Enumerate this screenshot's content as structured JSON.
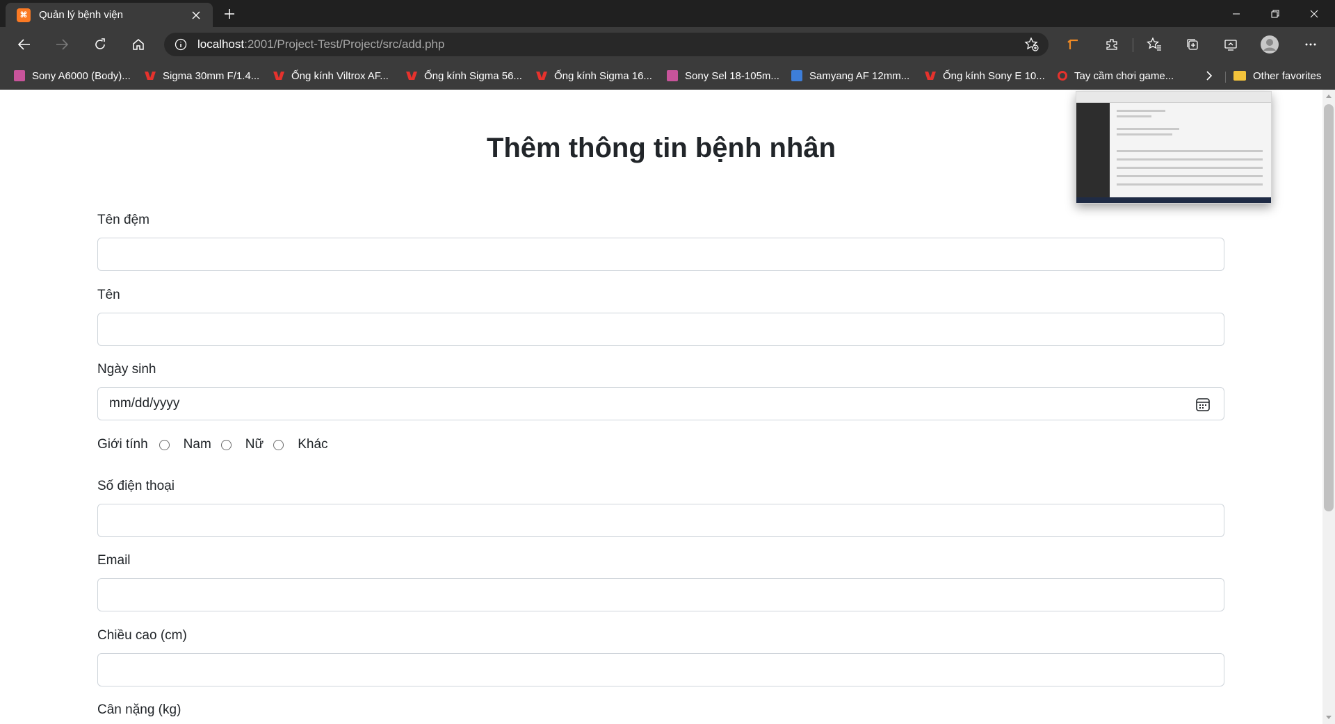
{
  "browser": {
    "tab": {
      "title": "Quản lý bệnh viện",
      "favicon": "xampp-icon"
    },
    "address": {
      "host": "localhost",
      "path": ":2001/Project-Test/Project/src/add.php"
    },
    "favorites": [
      {
        "label": "Sony A6000 (Body)...",
        "icon": "sony"
      },
      {
        "label": "Sigma 30mm F/1.4...",
        "icon": "v"
      },
      {
        "label": "Ống kính Viltrox AF...",
        "icon": "v"
      },
      {
        "label": "Ống kính Sigma 56...",
        "icon": "v"
      },
      {
        "label": "Ống kính Sigma 16...",
        "icon": "v"
      },
      {
        "label": "Sony Sel 18-105m...",
        "icon": "sony"
      },
      {
        "label": "Samyang AF 12mm...",
        "icon": "samyang"
      },
      {
        "label": "Ống kính Sony E 10...",
        "icon": "v"
      },
      {
        "label": "Tay cầm chơi game...",
        "icon": "game"
      }
    ],
    "other_favorites": "Other favorites"
  },
  "page": {
    "title": "Thêm thông tin bệnh nhân",
    "fields": {
      "middle_name": {
        "label": "Tên đệm",
        "value": ""
      },
      "first_name": {
        "label": "Tên",
        "value": ""
      },
      "dob": {
        "label": "Ngày sinh",
        "placeholder": "mm/dd/yyyy"
      },
      "gender": {
        "label": "Giới tính",
        "options": [
          "Nam",
          "Nữ",
          "Khác"
        ],
        "selected": null
      },
      "phone": {
        "label": "Số điện thoại",
        "value": ""
      },
      "email": {
        "label": "Email",
        "value": ""
      },
      "height": {
        "label": "Chiều cao (cm)",
        "value": ""
      },
      "weight": {
        "label": "Cân nặng (kg)"
      }
    }
  },
  "colors": {
    "chrome_dark": "#202020",
    "chrome_mid": "#3b3b3b",
    "input_border": "#ced4da",
    "text": "#212529"
  }
}
